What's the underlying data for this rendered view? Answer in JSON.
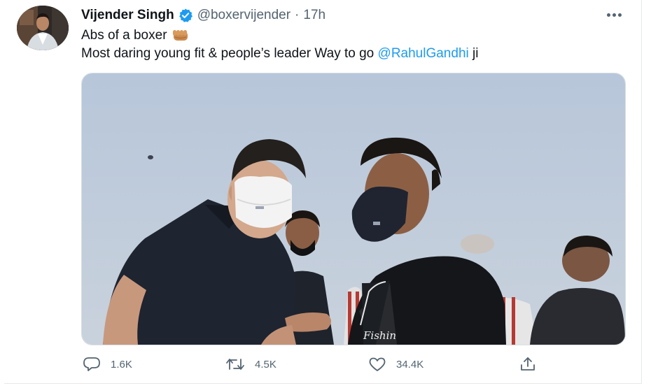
{
  "tweet": {
    "author_name": "Vijender Singh",
    "handle": "@boxervijender",
    "separator": "·",
    "time": "17h",
    "text_line1": "Abs of a boxer",
    "text_line2_before": "Most daring young fit & people’s leader Way to go ",
    "mention": "@RahulGandhi",
    "text_line2_after": " ji",
    "shirt_text": "Fishin"
  },
  "actions": {
    "reply_count": "1.6K",
    "retweet_count": "4.5K",
    "like_count": "34.4K"
  },
  "colors": {
    "accent": "#1d9bf0",
    "secondary_text": "#536471",
    "primary_text": "#0f1419"
  },
  "icons": [
    "verified-badge-icon",
    "fist-emoji-icon",
    "more-options-icon",
    "reply-icon",
    "retweet-icon",
    "like-icon",
    "share-icon"
  ]
}
